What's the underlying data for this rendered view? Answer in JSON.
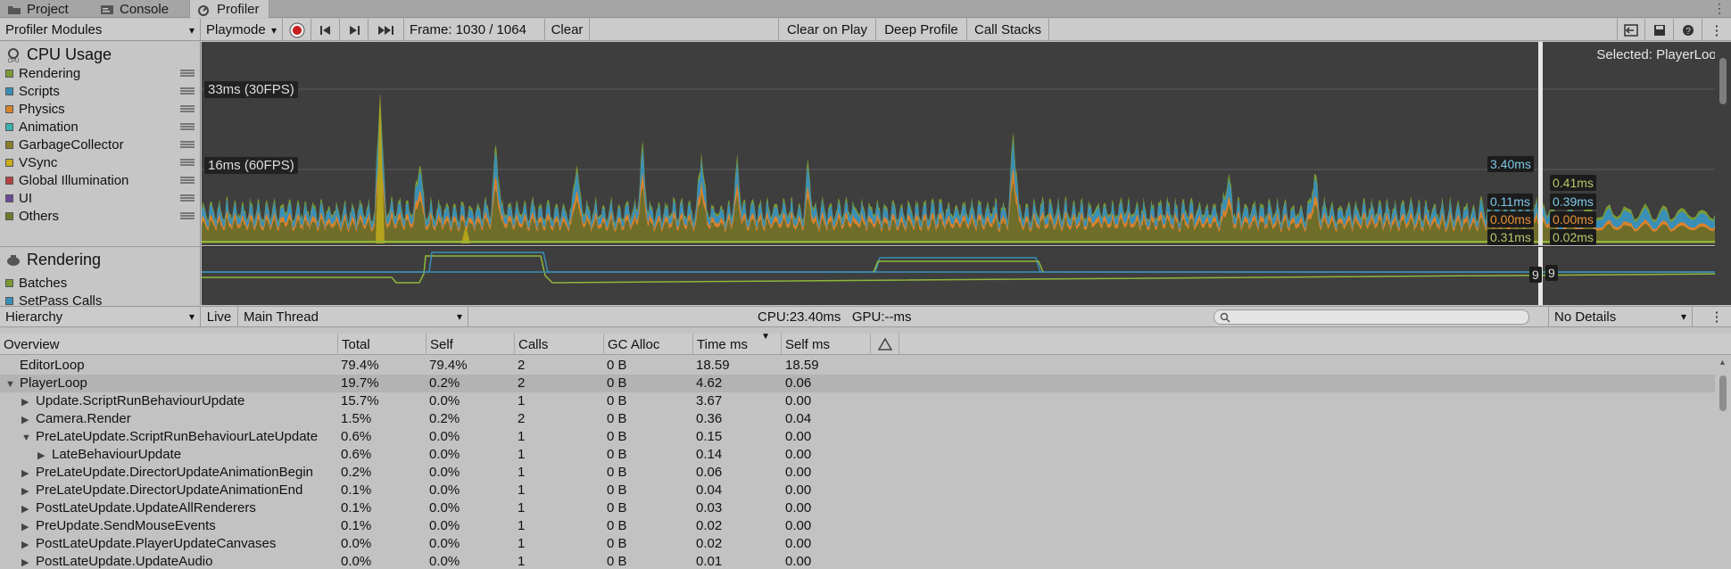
{
  "tabs": [
    {
      "label": "Project",
      "icon": "folder-icon"
    },
    {
      "label": "Console",
      "icon": "console-icon"
    },
    {
      "label": "Profiler",
      "icon": "profiler-icon",
      "active": true
    }
  ],
  "toolbar": {
    "modules_label": "Profiler Modules",
    "playmode_label": "Playmode",
    "frame_label": "Frame: 1030 / 1064",
    "clear_label": "Clear",
    "clear_on_play_label": "Clear on Play",
    "deep_profile_label": "Deep Profile",
    "call_stacks_label": "Call Stacks"
  },
  "cpu_module": {
    "title": "CPU Usage",
    "legend": [
      {
        "label": "Rendering",
        "color": "#7b9a34"
      },
      {
        "label": "Scripts",
        "color": "#3a8fb7"
      },
      {
        "label": "Physics",
        "color": "#d9822b"
      },
      {
        "label": "Animation",
        "color": "#3bb2b0"
      },
      {
        "label": "GarbageCollector",
        "color": "#8a7f29"
      },
      {
        "label": "VSync",
        "color": "#c9ad1b"
      },
      {
        "label": "Global Illumination",
        "color": "#b64141"
      },
      {
        "label": "UI",
        "color": "#6c4a96"
      },
      {
        "label": "Others",
        "color": "#6f7a2a"
      }
    ]
  },
  "rendering_module": {
    "title": "Rendering",
    "legend": [
      {
        "label": "Batches",
        "color": "#7b9a34"
      },
      {
        "label": "SetPass Calls",
        "color": "#3a8fb7"
      }
    ]
  },
  "chart": {
    "label_30fps": "33ms (30FPS)",
    "label_60fps": "16ms (60FPS)",
    "selected_label": "Selected: PlayerLoop",
    "left_values": [
      "3.40ms",
      "0.11ms",
      "0.00ms",
      "0.31ms"
    ],
    "right_values": [
      "0.41ms",
      "0.39ms",
      "0.00ms",
      "0.02ms"
    ],
    "right_colors": [
      "#b8c96a",
      "#7ec8e6",
      "#e8943a",
      "#b8c96a"
    ],
    "left_colors": [
      "#7ec8e6",
      "#7ec8e6",
      "#e8943a",
      "#b8c96a"
    ],
    "render_left": "9",
    "render_right": "9"
  },
  "bar2": {
    "view_label": "Hierarchy",
    "live_label": "Live",
    "thread_label": "Main Thread",
    "cpu_gpu_label": "CPU:23.40ms   GPU:--ms",
    "details_label": "No Details"
  },
  "table": {
    "columns": [
      "Overview",
      "Total",
      "Self",
      "Calls",
      "GC Alloc",
      "Time ms",
      "Self ms"
    ],
    "rows": [
      {
        "name": "EditorLoop",
        "indent": 0,
        "arrow": "",
        "total": "79.4%",
        "self": "79.4%",
        "calls": "2",
        "gc": "0 B",
        "time": "18.59",
        "selfms": "18.59"
      },
      {
        "name": "PlayerLoop",
        "indent": 0,
        "arrow": "open",
        "total": "19.7%",
        "self": "0.2%",
        "calls": "2",
        "gc": "0 B",
        "time": "4.62",
        "selfms": "0.06",
        "selected": true
      },
      {
        "name": "Update.ScriptRunBehaviourUpdate",
        "indent": 1,
        "arrow": "closed",
        "total": "15.7%",
        "self": "0.0%",
        "calls": "1",
        "gc": "0 B",
        "time": "3.67",
        "selfms": "0.00"
      },
      {
        "name": "Camera.Render",
        "indent": 1,
        "arrow": "closed",
        "total": "1.5%",
        "self": "0.2%",
        "calls": "2",
        "gc": "0 B",
        "time": "0.36",
        "selfms": "0.04"
      },
      {
        "name": "PreLateUpdate.ScriptRunBehaviourLateUpdate",
        "indent": 1,
        "arrow": "open",
        "total": "0.6%",
        "self": "0.0%",
        "calls": "1",
        "gc": "0 B",
        "time": "0.15",
        "selfms": "0.00"
      },
      {
        "name": "LateBehaviourUpdate",
        "indent": 2,
        "arrow": "closed",
        "total": "0.6%",
        "self": "0.0%",
        "calls": "1",
        "gc": "0 B",
        "time": "0.14",
        "selfms": "0.00"
      },
      {
        "name": "PreLateUpdate.DirectorUpdateAnimationBegin",
        "indent": 1,
        "arrow": "closed",
        "total": "0.2%",
        "self": "0.0%",
        "calls": "1",
        "gc": "0 B",
        "time": "0.06",
        "selfms": "0.00"
      },
      {
        "name": "PreLateUpdate.DirectorUpdateAnimationEnd",
        "indent": 1,
        "arrow": "closed",
        "total": "0.1%",
        "self": "0.0%",
        "calls": "1",
        "gc": "0 B",
        "time": "0.04",
        "selfms": "0.00"
      },
      {
        "name": "PostLateUpdate.UpdateAllRenderers",
        "indent": 1,
        "arrow": "closed",
        "total": "0.1%",
        "self": "0.0%",
        "calls": "1",
        "gc": "0 B",
        "time": "0.03",
        "selfms": "0.00"
      },
      {
        "name": "PreUpdate.SendMouseEvents",
        "indent": 1,
        "arrow": "closed",
        "total": "0.1%",
        "self": "0.0%",
        "calls": "1",
        "gc": "0 B",
        "time": "0.02",
        "selfms": "0.00"
      },
      {
        "name": "PostLateUpdate.PlayerUpdateCanvases",
        "indent": 1,
        "arrow": "closed",
        "total": "0.0%",
        "self": "0.0%",
        "calls": "1",
        "gc": "0 B",
        "time": "0.02",
        "selfms": "0.00"
      },
      {
        "name": "PostLateUpdate.UpdateAudio",
        "indent": 1,
        "arrow": "closed",
        "total": "0.0%",
        "self": "0.0%",
        "calls": "1",
        "gc": "0 B",
        "time": "0.01",
        "selfms": "0.00"
      }
    ]
  }
}
